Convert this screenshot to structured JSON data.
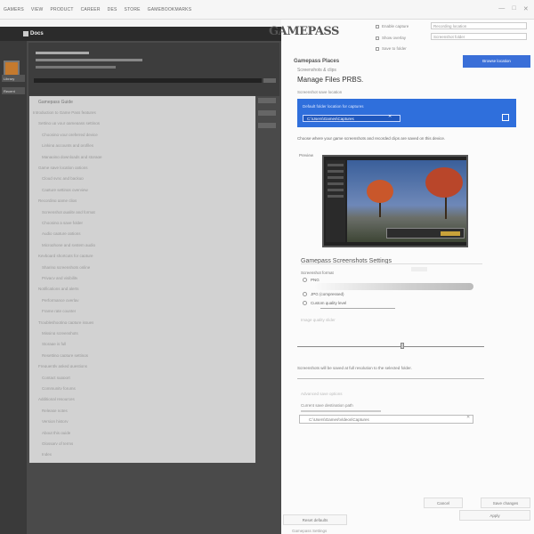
{
  "menubar": {
    "items": [
      "GAMERS",
      "VIEW",
      "PRODUCT",
      "CAREER",
      "DES",
      "STORE",
      "GAMEBOOKMARKS"
    ],
    "window_controls": [
      "—",
      "□",
      "✕"
    ]
  },
  "dark_app": {
    "title": "Docs",
    "side_items": [
      "Library",
      "Recent"
    ]
  },
  "document": {
    "title": "Gamepass Guide",
    "lines": [
      "Introduction to Game Pass features",
      "Setting up your gamepass settings",
      "Choosing your preferred device",
      "Linking accounts and profiles",
      "Managing downloads and storage",
      "Game save location options",
      "Cloud sync and backup",
      "Capture settings overview",
      "Recording game clips",
      "Screenshot quality and format",
      "Choosing a save folder",
      "Audio capture options",
      "Microphone and system audio",
      "Keyboard shortcuts for capture",
      "Sharing screenshots online",
      "Privacy and visibility",
      "Notifications and alerts",
      "Performance overlay",
      "Frame rate counter",
      "Troubleshooting capture issues",
      "Missing screenshots",
      "Storage is full",
      "Resetting capture settings",
      "Frequently asked questions",
      "Contact support",
      "Community forums",
      "Additional resources",
      "Release notes",
      "Version history",
      "About this guide",
      "Glossary of terms",
      "Index"
    ]
  },
  "settings": {
    "logo": "GAMEPASS",
    "options": [
      "Enable capture",
      "Show overlay",
      "Save to folder"
    ],
    "option_inputs": [
      "Recording location",
      "Screenshot folder"
    ],
    "blue_button": "Browse location",
    "section_title": "Gamepass Places",
    "section_sub": "Screenshots & clips",
    "section_head": "Manage Files PRBS.",
    "section_label": "Screenshot save location",
    "blue_panel": {
      "line": "Default folder location for captures",
      "field": "C:\\Users\\Games\\Captures",
      "clear": "✕"
    },
    "description": "Choose where your game screenshots and recorded clips are saved on this device.",
    "shot_label": "Preview",
    "screenshot_section": {
      "title": "Gamepass Screenshots Settings",
      "sub": "Screenshot format",
      "radio_options": [
        "PNG",
        "JPG (compressed)",
        "Custom quality level"
      ],
      "faded_label": "Image quality slider",
      "info_line": "Screenshots will be saved at full resolution to the selected folder.",
      "faded2": "Advanced save options",
      "faded3": "Current save destination path",
      "path": "C:\\Users\\Games\\Videos\\Captures",
      "path_clear": "✕"
    },
    "buttons": {
      "cancel": "Cancel",
      "save": "Save changes",
      "apply": "Apply",
      "reset": "Reset defaults"
    },
    "footer": "Gamepass Settings"
  },
  "colors": {
    "accent": "#2f6fdc",
    "dark_bg": "#4a4a4a",
    "doc_bg": "#d2d2d2"
  },
  "slider_level": 0.6,
  "range_level": 0.55
}
